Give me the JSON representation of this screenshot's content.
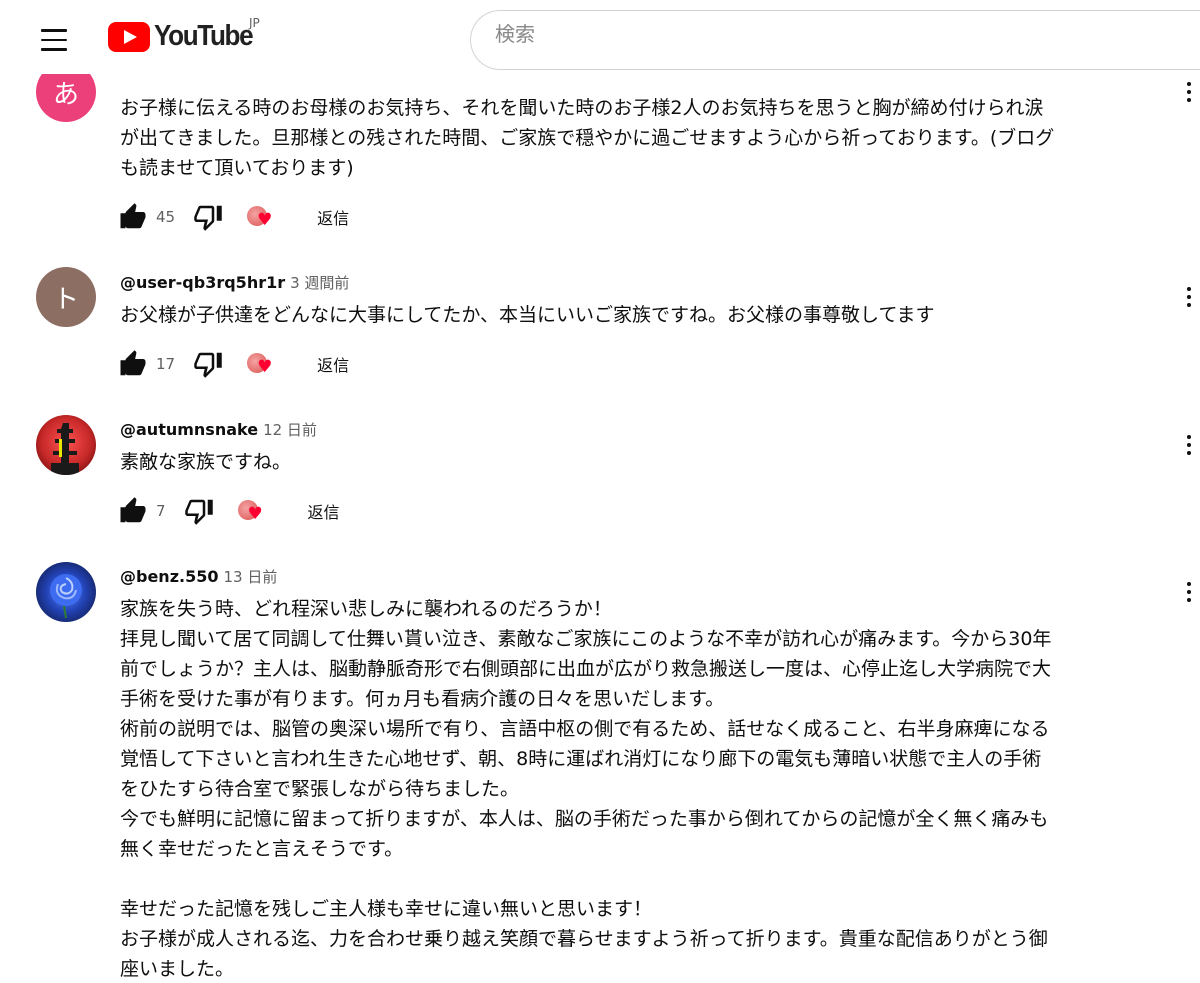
{
  "header": {
    "logo_text": "YouTube",
    "region": "JP",
    "search_placeholder": "検索"
  },
  "comments": [
    {
      "avatar_letter": "あ",
      "avatar_color": "#ec407a",
      "author": "",
      "time": "",
      "text": "お子様に伝える時のお母様のお気持ち、それを聞いた時のお子様2人のお気持ちを思うと胸が締め付けられ涙\nが出てきました。旦那様との残された時間、ご家族で穏やかに過ごせますよう心から祈っております。(ブログ\nも読ませて頂いております)",
      "likes": "45",
      "reply_label": "返信"
    },
    {
      "avatar_letter": "ト",
      "avatar_color": "#8d6e63",
      "author": "@user-qb3rq5hr1r",
      "time": "3 週間前",
      "text": "お父様が子供達をどんなに大事にしてたか、本当にいいご家族ですね。お父様の事尊敬してます",
      "likes": "17",
      "reply_label": "返信"
    },
    {
      "avatar_letter": "",
      "avatar_color": "#c62828",
      "author": "@autumnsnake",
      "time": "12 日前",
      "text": "素敵な家族ですね。",
      "likes": "7",
      "reply_label": "返信"
    },
    {
      "avatar_letter": "",
      "avatar_color": "#1a237e",
      "author": "@benz.550",
      "time": "13 日前",
      "text": "家族を失う時、どれ程深い悲しみに襲われるのだろうか！\n拝見し聞いて居て同調して仕舞い貰い泣き、素敵なご家族にこのような不幸が訪れ心が痛みます。今から30年\n前でしょうか？主人は、脳動静脈奇形で右側頭部に出血が広がり救急搬送し一度は、心停止迄し大学病院で大\n手術を受けた事が有ります。何ヵ月も看病介護の日々を思いだします。\n術前の説明では、脳管の奥深い場所で有り、言語中枢の側で有るため、話せなく成ること、右半身麻痺になる\n覚悟して下さいと言われ生きた心地せず、朝、8時に運ばれ消灯になり廊下の電気も薄暗い状態で主人の手術\nをひたすら待合室で緊張しながら待ちました。\n今でも鮮明に記憶に留まって折りますが、本人は、脳の手術だった事から倒れてからの記憶が全く無く痛みも\n無く幸せだったと言えそうです。\n\n幸せだった記憶を残しご主人様も幸せに違い無いと思います！\nお子様が成人される迄、力を合わせ乗り越え笑顔で暮らせますよう祈って折ります。貴重な配信ありがとう御\n座いました。"
    }
  ]
}
